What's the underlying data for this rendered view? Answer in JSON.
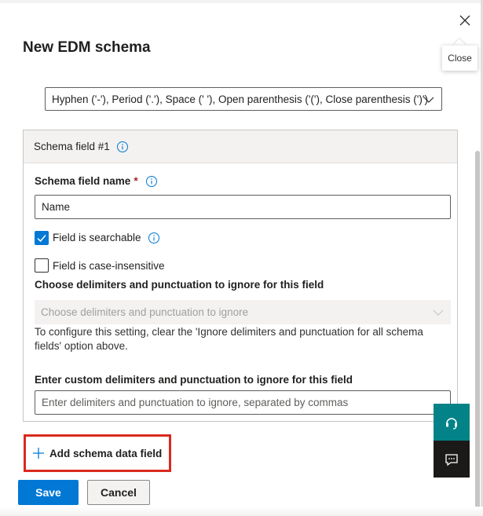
{
  "dialog": {
    "title": "New EDM schema",
    "close_tooltip": "Close"
  },
  "delimiters_dropdown": {
    "selected": "Hyphen ('-'), Period ('.'), Space (' '), Open parenthesis ('('), Close parenthesis (')')"
  },
  "schema_field": {
    "header": "Schema field #1",
    "name_label": "Schema field name",
    "required_marker": "*",
    "name_value": "Name",
    "searchable": {
      "label": "Field is searchable",
      "checked": true
    },
    "case_insensitive": {
      "label": "Field is case-insensitive",
      "checked": false
    },
    "delimiters_label": "Choose delimiters and punctuation to ignore for this field",
    "delimiters_placeholder": "Choose delimiters and punctuation to ignore",
    "delimiters_help": "To configure this setting, clear the 'Ignore delimiters and punctuation for all schema fields' option above.",
    "custom_label": "Enter custom delimiters and punctuation to ignore for this field",
    "custom_placeholder": "Enter delimiters and punctuation to ignore, separated by commas"
  },
  "actions": {
    "add_field_label": "Add schema data field",
    "save_label": "Save",
    "cancel_label": "Cancel"
  },
  "side_buttons": {
    "help_icon": "headset-icon",
    "feedback_icon": "feedback-icon"
  },
  "colors": {
    "accent": "#0078d4",
    "highlight": "#d92a1e",
    "help_button": "#038387",
    "feedback_button": "#1b1a19"
  }
}
